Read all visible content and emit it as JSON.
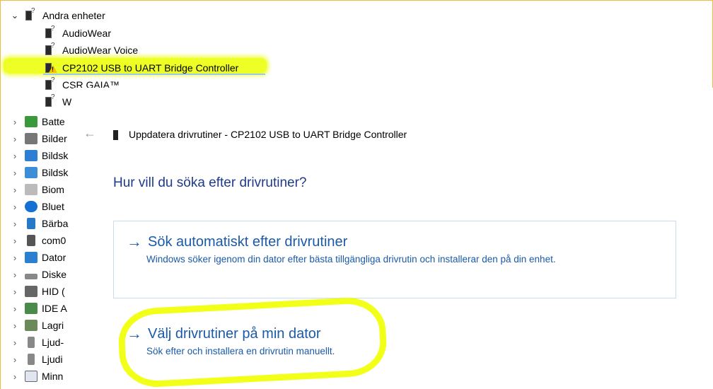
{
  "device_manager": {
    "other_devices": {
      "label": "Andra enheter",
      "children": [
        "AudioWear",
        "AudioWear Voice",
        "CP2102 USB to UART Bridge Controller",
        "CSR GAIA™",
        "W"
      ]
    },
    "categories": [
      "Batte",
      "Bilder",
      "Bildsk",
      "Bildsk",
      "Biom",
      "Bluet",
      "Bärba",
      "com0",
      "Dator",
      "Diske",
      "HID (",
      "IDE A",
      "Lagri",
      "Ljud-",
      "Ljudi",
      "Minn"
    ]
  },
  "wizard": {
    "title": "Uppdatera drivrutiner - CP2102 USB to UART Bridge Controller",
    "question": "Hur vill du söka efter drivrutiner?",
    "auto": {
      "title": "Sök automatiskt efter drivrutiner",
      "desc": "Windows söker igenom din dator efter bästa tillgängliga drivrutin och installerar den på din enhet."
    },
    "manual": {
      "title": "Välj drivrutiner på min dator",
      "desc": "Sök efter och installera en drivrutin manuellt."
    }
  },
  "colors": {
    "link_blue": "#1a5aa8",
    "highlight_yellow": "#ebff00",
    "title_blue": "#1e3b8a"
  }
}
